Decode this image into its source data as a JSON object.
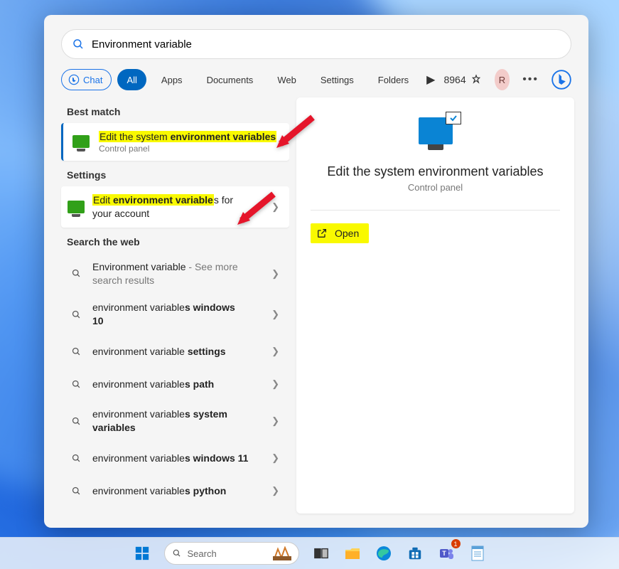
{
  "search": {
    "query": "Environment variable"
  },
  "filters": {
    "chat": "Chat",
    "all": "All",
    "apps": "Apps",
    "documents": "Documents",
    "web": "Web",
    "settings": "Settings",
    "folders": "Folders"
  },
  "points": "8964",
  "avatar_initial": "R",
  "sections": {
    "best_match": "Best match",
    "settings": "Settings",
    "web": "Search the web"
  },
  "best_match": {
    "prefix": "Edit the system ",
    "highlight": "environment variables",
    "subtitle": "Control panel"
  },
  "settings_item": {
    "prefix": "Edit ",
    "highlight": "environment variable",
    "suffix": "s for your account"
  },
  "web_results": [
    {
      "prefix": "Environment variable",
      "bold": "",
      "suffix": " - See more search results"
    },
    {
      "prefix": "environment variable",
      "bold": "s windows 10",
      "suffix": ""
    },
    {
      "prefix": "environment variable ",
      "bold": "settings",
      "suffix": ""
    },
    {
      "prefix": "environment variable",
      "bold": "s path",
      "suffix": ""
    },
    {
      "prefix": "environment variable",
      "bold": "s system variables",
      "suffix": ""
    },
    {
      "prefix": "environment variable",
      "bold": "s windows 11",
      "suffix": ""
    },
    {
      "prefix": "environment variable",
      "bold": "s python",
      "suffix": ""
    }
  ],
  "preview": {
    "title": "Edit the system environment variables",
    "subtitle": "Control panel",
    "open": "Open"
  },
  "taskbar": {
    "search_placeholder": "Search"
  }
}
